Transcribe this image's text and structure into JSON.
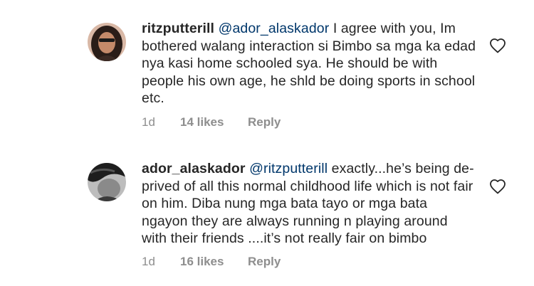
{
  "comments": [
    {
      "username": "ritzputterill",
      "mention": "@ador_alaskador",
      "text": " I agree with you, Im bothered walang interaction si Bimbo sa mga ka edad nya kasi home schooled sya. He should be with people his own age, he shld be doing sports in school etc.",
      "time": "1d",
      "likes": "14 likes",
      "reply_label": "Reply"
    },
    {
      "username": "ador_alaskador",
      "mention": "@ritzputterill",
      "text": " exactly...he’s being de-prived of all this normal childhood life which is not fair on him. Diba nung mga bata tayo or mga bata ngayon they are always running n playing around with their friends ....it’s not really fair on bimbo",
      "time": "1d",
      "likes": "16 likes",
      "reply_label": "Reply"
    }
  ],
  "colors": {
    "text": "#262626",
    "mention": "#00376b",
    "meta": "#8e8e8e"
  },
  "icons": {
    "like": "heart-outline-icon"
  }
}
